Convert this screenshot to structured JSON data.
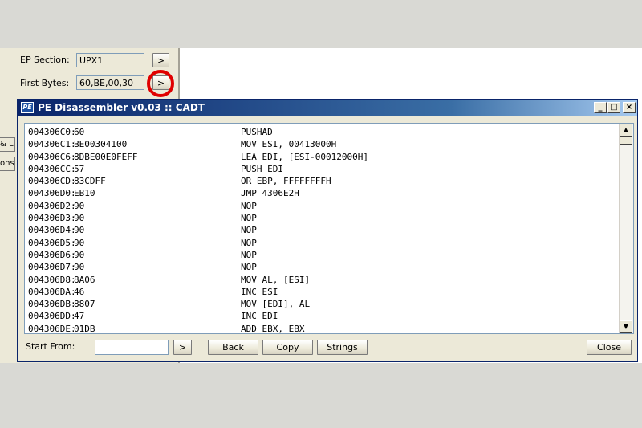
{
  "background_panel": {
    "ep_section": {
      "label": "EP Section:",
      "value": "UPX1",
      "button": ">"
    },
    "first_bytes": {
      "label": "First Bytes:",
      "value": "60,BE,00,30",
      "button": ">"
    },
    "left_stubs": [
      "& Lo",
      "ons"
    ]
  },
  "dialog": {
    "icon_text": "PE",
    "title": "PE Disassembler v0.03 :: CADT",
    "caption_buttons": {
      "minimize": "_",
      "maximize": "□",
      "close": "×"
    },
    "rows": [
      {
        "addr": "004306C0:",
        "bytes": "60",
        "instr": "PUSHAD"
      },
      {
        "addr": "004306C1:",
        "bytes": "BE00304100",
        "instr": "MOV ESI, 00413000H"
      },
      {
        "addr": "004306C6:",
        "bytes": "8DBE00E0FEFF",
        "instr": "LEA EDI, [ESI-00012000H]"
      },
      {
        "addr": "004306CC:",
        "bytes": "57",
        "instr": "PUSH EDI"
      },
      {
        "addr": "004306CD:",
        "bytes": "83CDFF",
        "instr": "OR EBP, FFFFFFFFH"
      },
      {
        "addr": "004306D0:",
        "bytes": "EB10",
        "instr": "JMP 4306E2H"
      },
      {
        "addr": "004306D2:",
        "bytes": "90",
        "instr": "NOP"
      },
      {
        "addr": "004306D3:",
        "bytes": "90",
        "instr": "NOP"
      },
      {
        "addr": "004306D4:",
        "bytes": "90",
        "instr": "NOP"
      },
      {
        "addr": "004306D5:",
        "bytes": "90",
        "instr": "NOP"
      },
      {
        "addr": "004306D6:",
        "bytes": "90",
        "instr": "NOP"
      },
      {
        "addr": "004306D7:",
        "bytes": "90",
        "instr": "NOP"
      },
      {
        "addr": "004306D8:",
        "bytes": "8A06",
        "instr": "MOV AL, [ESI]"
      },
      {
        "addr": "004306DA:",
        "bytes": "46",
        "instr": "INC ESI"
      },
      {
        "addr": "004306DB:",
        "bytes": "8807",
        "instr": "MOV [EDI], AL"
      },
      {
        "addr": "004306DD:",
        "bytes": "47",
        "instr": "INC EDI"
      },
      {
        "addr": "004306DE:",
        "bytes": "01DB",
        "instr": "ADD EBX, EBX"
      }
    ],
    "footer": {
      "start_from_label": "Start From:",
      "start_from_value": "",
      "go_button": ">",
      "back_button": "Back",
      "copy_button": "Copy",
      "strings_button": "Strings",
      "close_button": "Close"
    },
    "scrollbar": {
      "up": "▲",
      "down": "▼"
    }
  },
  "colors": {
    "title_gradient_start": "#0a246a",
    "title_gradient_end": "#a6caf0",
    "highlight_circle": "#e00000"
  }
}
